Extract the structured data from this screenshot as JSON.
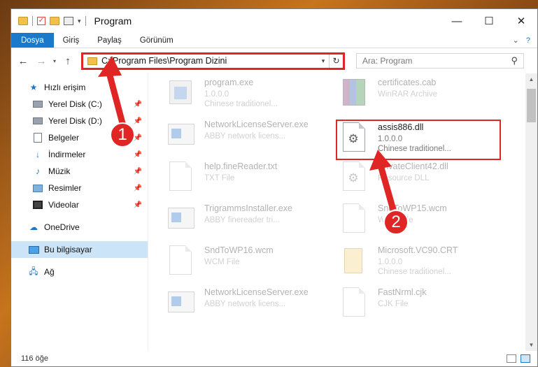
{
  "window": {
    "title": "Program",
    "controls": {
      "minimize": "—",
      "maximize": "☐",
      "close": "✕"
    }
  },
  "ribbon": {
    "tabs": [
      {
        "label": "Dosya",
        "active": true
      },
      {
        "label": "Giriş"
      },
      {
        "label": "Paylaş"
      },
      {
        "label": "Görünüm"
      }
    ]
  },
  "address": {
    "path": "C:\\Program Files\\Program Dizini",
    "search_placeholder": "Ara: Program"
  },
  "sidebar": {
    "quick_access": "Hızlı erişim",
    "items": [
      {
        "label": "Yerel Disk (C:)",
        "icon": "disk-icon"
      },
      {
        "label": "Yerel Disk (D:)",
        "icon": "disk-icon"
      },
      {
        "label": "Belgeler",
        "icon": "documents-icon"
      },
      {
        "label": "İndirmeler",
        "icon": "downloads-icon"
      },
      {
        "label": "Müzik",
        "icon": "music-icon"
      },
      {
        "label": "Resimler",
        "icon": "pictures-icon"
      },
      {
        "label": "Videolar",
        "icon": "videos-icon"
      }
    ],
    "onedrive": "OneDrive",
    "this_pc": "Bu bilgisayar",
    "network": "Ağ"
  },
  "files": [
    {
      "name": "program.exe",
      "line2": "1.0.0.0",
      "line3": "Chinese traditionel..."
    },
    {
      "name": "certificates.cab",
      "line2": "WinRAR Archive",
      "line3": ""
    },
    {
      "name": "NetworkLicenseServer.exe",
      "line2": "ABBY network licens...",
      "line3": ""
    },
    {
      "name": "assis886.dll",
      "line2": "1.0.0.0",
      "line3": "Chinese traditionel..."
    },
    {
      "name": "help.fineReader.txt",
      "line2": "TXT File",
      "line3": ""
    },
    {
      "name": "PrivateClient42.dll",
      "line2": "Resource DLL",
      "line3": ""
    },
    {
      "name": "TrigrammsInstaller.exe",
      "line2": "ABBY finereader tri...",
      "line3": ""
    },
    {
      "name": "SndToWP15.wcm",
      "line2": "WCM File",
      "line3": ""
    },
    {
      "name": "SndToWP16.wcm",
      "line2": "WCM File",
      "line3": ""
    },
    {
      "name": "Microsoft.VC90.CRT",
      "line2": "1.0.0.0",
      "line3": "Chinese traditionel..."
    },
    {
      "name": "NetworkLicenseServer.exe",
      "line2": "ABBY network licens...",
      "line3": ""
    },
    {
      "name": "FastNrml.cjk",
      "line2": "CJK File",
      "line3": ""
    }
  ],
  "status": {
    "count": "116 öğe"
  },
  "callouts": {
    "one": "1",
    "two": "2"
  },
  "colors": {
    "accent": "#1979ca",
    "highlight": "#e02525"
  }
}
